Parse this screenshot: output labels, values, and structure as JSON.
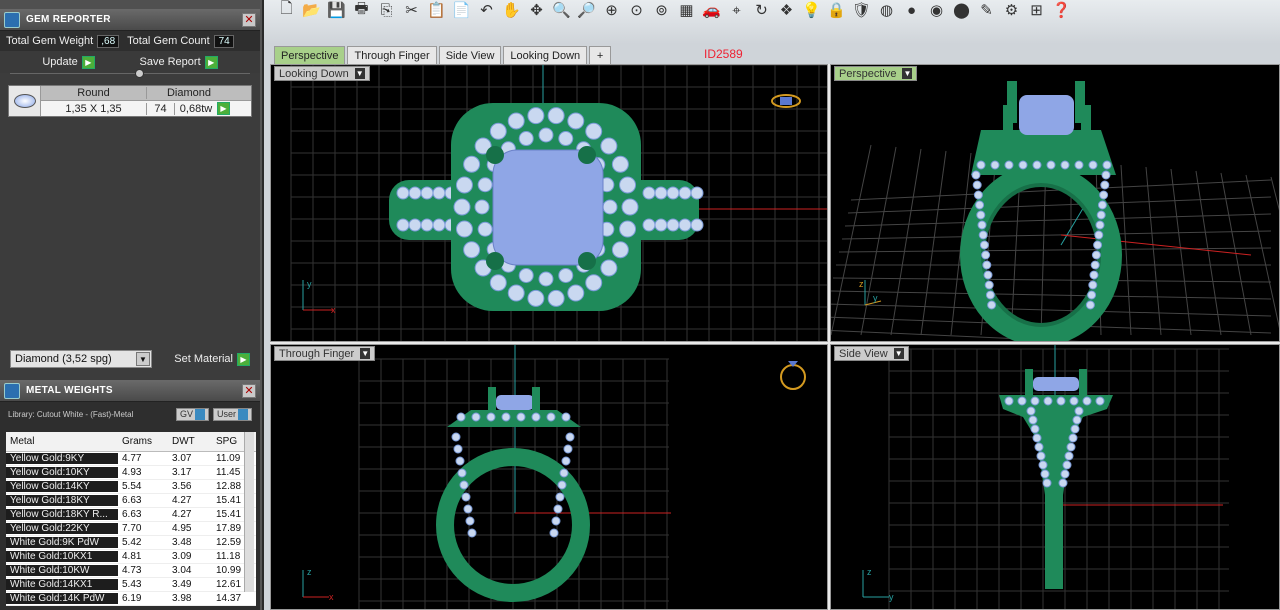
{
  "gem_reporter": {
    "title": "GEM REPORTER",
    "total_weight_label": "Total Gem Weight",
    "total_weight_value": ",68",
    "total_count_label": "Total Gem Count",
    "total_count_value": "74",
    "update_label": "Update",
    "save_label": "Save Report",
    "table": {
      "headers": [
        "Round",
        "Diamond"
      ],
      "row": [
        "1,35 X 1,35",
        "74",
        "0,68tw"
      ]
    },
    "material_select": "Diamond    (3,52 spg)",
    "set_material_label": "Set Material"
  },
  "metal_weights": {
    "title": "METAL WEIGHTS",
    "library": "Library: Cutout White - (Fast)-Metal",
    "gv_label": "GV",
    "user_label": "User",
    "headers": [
      "Metal",
      "Grams",
      "DWT",
      "SPG"
    ],
    "rows": [
      [
        "Yellow Gold:9KY",
        "4.77",
        "3.07",
        "11.09"
      ],
      [
        "Yellow Gold:10KY",
        "4.93",
        "3.17",
        "11.45"
      ],
      [
        "Yellow Gold:14KY",
        "5.54",
        "3.56",
        "12.88"
      ],
      [
        "Yellow Gold:18KY",
        "6.63",
        "4.27",
        "15.41"
      ],
      [
        "Yellow Gold:18KY R...",
        "6.63",
        "4.27",
        "15.41"
      ],
      [
        "Yellow Gold:22KY",
        "7.70",
        "4.95",
        "17.89"
      ],
      [
        "White Gold:9K PdW",
        "5.42",
        "3.48",
        "12.59"
      ],
      [
        "White Gold:10KX1",
        "4.81",
        "3.09",
        "11.18"
      ],
      [
        "White Gold:10KW",
        "4.73",
        "3.04",
        "10.99"
      ],
      [
        "White Gold:14KX1",
        "5.43",
        "3.49",
        "12.61"
      ],
      [
        "White Gold:14K PdW",
        "6.19",
        "3.98",
        "14.37"
      ]
    ]
  },
  "tabs": [
    "Perspective",
    "Through Finger",
    "Side View",
    "Looking Down",
    "+"
  ],
  "id_label": "ID2589",
  "viewports": {
    "looking_down": "Looking Down",
    "perspective": "Perspective",
    "through_finger": "Through Finger",
    "side_view": "Side View"
  },
  "colors": {
    "metal_green": "#1f8a5a",
    "gem_blue": "#8fa6e6",
    "accent_tab": "#a8d08a"
  }
}
